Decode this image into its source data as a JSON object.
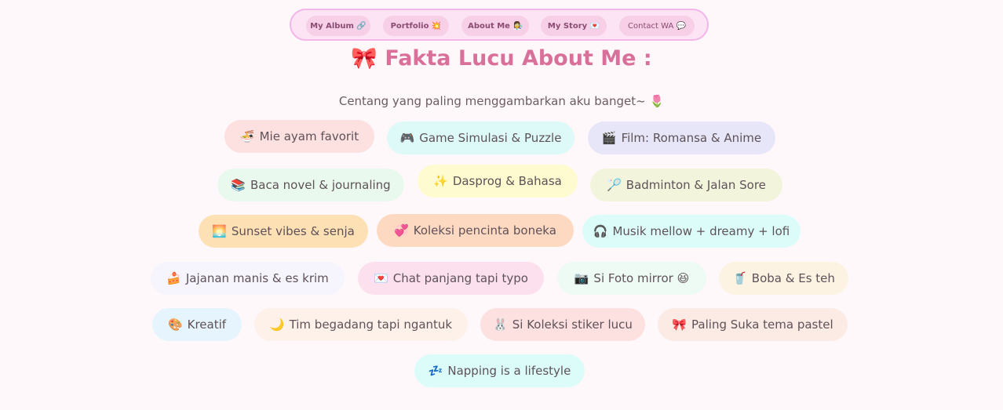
{
  "nav": [
    {
      "label": "My Album 🔗"
    },
    {
      "label": "Portfolio 💥"
    },
    {
      "label": "About Me 👩‍🔬"
    },
    {
      "label": "My Story 💌"
    },
    {
      "label": "Contact WA 💬"
    }
  ],
  "title": "🎀 Fakta Lucu About Me :",
  "subtitle": "Centang yang paling menggambarkan aku banget~ 🌷",
  "chips": [
    {
      "icon": "🍜",
      "label": "Mie ayam favorit",
      "color": "#fde0e0"
    },
    {
      "icon": "🎮",
      "label": "Game Simulasi & Puzzle",
      "color": "#ddfaf8"
    },
    {
      "icon": "🎬",
      "label": "Film: Romansa & Anime",
      "color": "#e6e6f8"
    },
    {
      "icon": "📚",
      "label": "Baca novel & journaling",
      "color": "#eaf9ee"
    },
    {
      "icon": "✨",
      "label": "Dasprog & Bahasa",
      "color": "#fdfbcf"
    },
    {
      "icon": "🏸",
      "label": "Badminton & Jalan Sore",
      "color": "#f3f4dc"
    },
    {
      "icon": "🌅",
      "label": "Sunset vibes & senja",
      "color": "#fde1b4"
    },
    {
      "icon": "💞",
      "label": "Koleksi pencinta boneka",
      "color": "#fed9c2"
    },
    {
      "icon": "🎧",
      "label": "Musik mellow + dreamy + lofi",
      "color": "#dcfcfa"
    },
    {
      "icon": "🍰",
      "label": "Jajanan manis & es krim",
      "color": "#f6f4fc"
    },
    {
      "icon": "💌",
      "label": "Chat panjang tapi typo",
      "color": "#fce0ee"
    },
    {
      "icon": "📷",
      "label": "Si Foto mirror 😆",
      "color": "#edfbf4"
    },
    {
      "icon": "🥤",
      "label": "Boba & Es teh",
      "color": "#fcf3e2"
    },
    {
      "icon": "🎨",
      "label": "Kreatif",
      "color": "#e6f5fd"
    },
    {
      "icon": "🌙",
      "label": "Tim begadang tapi ngantuk",
      "color": "#fdf1ea"
    },
    {
      "icon": "🐰",
      "label": "Si Koleksi stiker lucu",
      "color": "#fde0e0"
    },
    {
      "icon": "🎀",
      "label": "Paling Suka tema pastel",
      "color": "#fbebe4"
    },
    {
      "icon": "💤",
      "label": "Napping is a lifestyle",
      "color": "#dcfcfa"
    }
  ]
}
